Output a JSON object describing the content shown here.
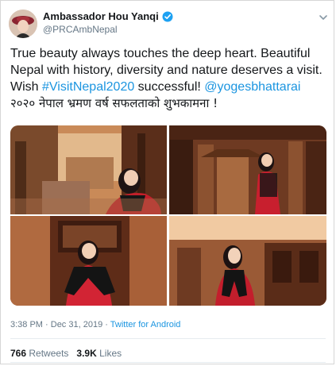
{
  "author": {
    "display_name": "Ambassador Hou Yanqi",
    "handle": "@PRCAmbNepal",
    "verified": true
  },
  "icons": {
    "verified": "verified-badge-icon",
    "caret": "chevron-down-icon"
  },
  "tweet": {
    "text_part1": "True beauty always touches the deep heart.  Beautiful Nepal with history, diversity and nature deserves a visit. Wish ",
    "hashtag": "#VisitNepal2020",
    "text_part2": " successful! ",
    "mention": "@yogesbhattarai",
    "text_nepali": "२०२० नेपाल भ्रमण वर्ष सफलताको शुभकामना !"
  },
  "photos": [
    {
      "name": "photo-1"
    },
    {
      "name": "photo-2"
    },
    {
      "name": "photo-3"
    },
    {
      "name": "photo-4"
    }
  ],
  "meta": {
    "time": "3:38 PM",
    "separator": " · ",
    "date": "Dec 31, 2019",
    "source": "Twitter for Android"
  },
  "stats": {
    "retweets_count": "766",
    "retweets_label": "Retweets",
    "likes_count": "3.9K",
    "likes_label": "Likes"
  },
  "colors": {
    "link": "#1b95e0",
    "secondary_text": "#657786",
    "primary_text": "#14171a",
    "verified": "#1da1f2"
  }
}
